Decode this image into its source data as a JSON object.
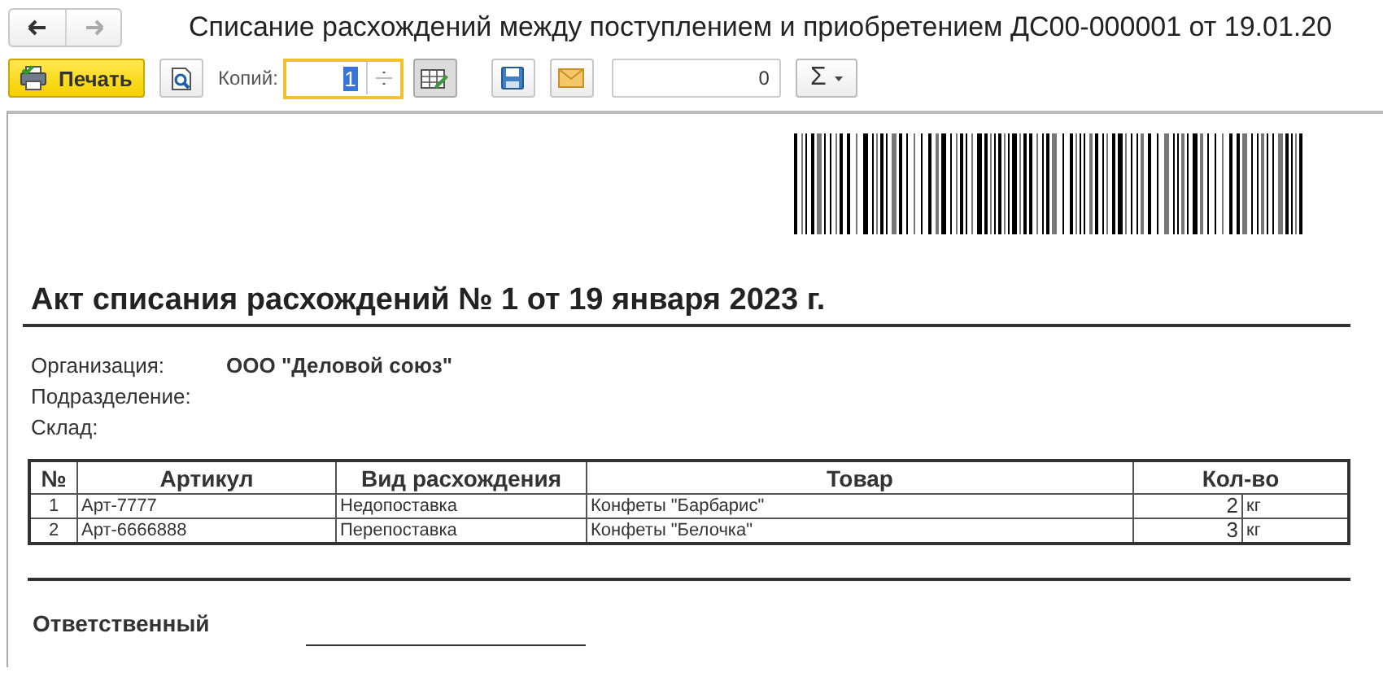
{
  "window": {
    "title": "Списание расхождений между поступлением и приобретением ДС00-000001 от 19.01.20"
  },
  "nav": [
    {
      "kind": "back",
      "disabled": false
    },
    {
      "kind": "forward",
      "disabled": true
    }
  ],
  "toolbar": {
    "print_label": "Печать",
    "copies_label": "Копий:",
    "copies_value": "1",
    "copies_focused": true,
    "edit_pressed": true,
    "counter_value": "0",
    "sum_label": "Σ"
  },
  "document": {
    "title": "Акт списания расхождений № 1 от 19 января 2023 г.",
    "fields": [
      {
        "label": "Организация:",
        "value": "ООО \"Деловой союз\""
      },
      {
        "label": "Подразделение:"
      },
      {
        "label": "Склад:"
      }
    ],
    "table": {
      "columns": [
        "№",
        "Артикул",
        "Вид расхождения",
        "Товар",
        "Кол-во"
      ],
      "rows": [
        {
          "number": "1",
          "article": "Арт-7777",
          "kind": "Недопоставка",
          "product": "Конфеты \"Барбарис\"",
          "quantity": "2",
          "unit": "кг"
        },
        {
          "number": "2",
          "article": "Арт-6666888",
          "kind": "Перепоставка",
          "product": "Конфеты \"Белочка\"",
          "quantity": "3",
          "unit": "кг"
        }
      ]
    },
    "signature_label": "Ответственный"
  }
}
